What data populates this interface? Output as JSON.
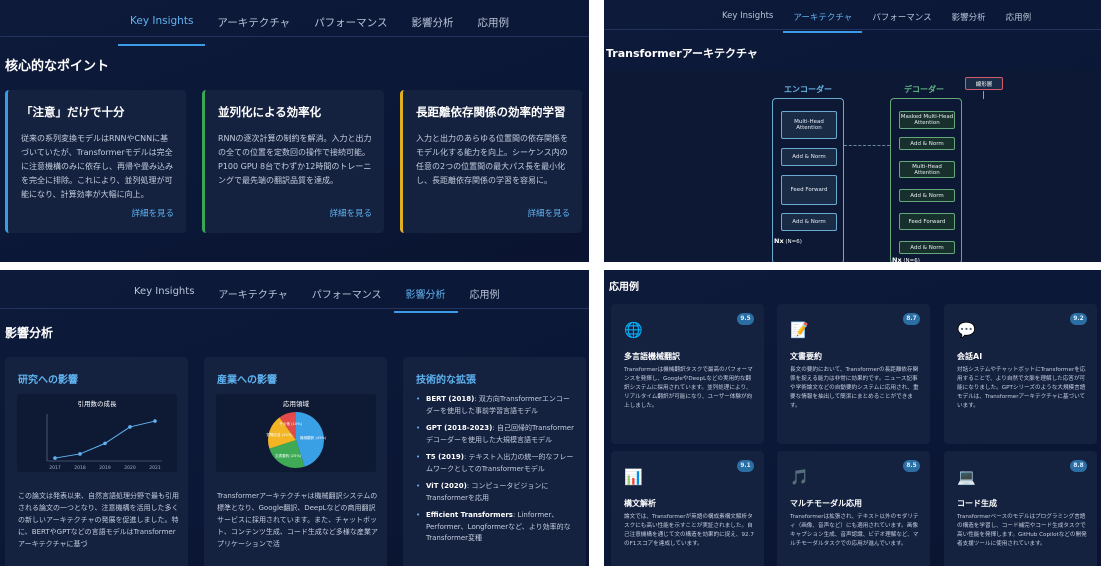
{
  "tabs": [
    "Key Insights",
    "アーキテクチャ",
    "パフォーマンス",
    "影響分析",
    "応用例"
  ],
  "insights": {
    "title": "核心的なポイント",
    "more_label": "詳細を見る",
    "cards": [
      {
        "title": "「注意」だけで十分",
        "body": "従来の系列変換モデルはRNNやCNNに基づいていたが、Transformerモデルは完全に注意機構のみに依存し、再帰や畳み込みを完全に排除。これにより、並列処理が可能になり、計算効率が大幅に向上。",
        "accent": "#3b9be6"
      },
      {
        "title": "並列化による効率化",
        "body": "RNNの逐次計算の制約を解消。入力と出力の全ての位置を定数回の操作で接続可能。P100 GPU 8台でわずか12時間のトレーニングで最先端の翻訳品質を達成。",
        "accent": "#3aa557"
      },
      {
        "title": "長距離依存関係の効率的学習",
        "body": "入力と出力のあらゆる位置間の依存関係をモデル化する能力を向上。シーケンス内の任意の2つの位置間の最大パス長を最小化し、長距離依存関係の学習を容易に。",
        "accent": "#e0b021"
      }
    ]
  },
  "architecture": {
    "title": "Transformerアーキテクチャ",
    "encoder_label": "エンコーダー",
    "decoder_label": "デコーダー",
    "output_label": "線形層",
    "encoder_blocks": [
      "Multi-Head Attention",
      "Add & Norm",
      "Feed Forward",
      "Add & Norm"
    ],
    "decoder_blocks": [
      "Masked Multi-Head Attention",
      "Add & Norm",
      "Multi-Head Attention",
      "Add & Norm",
      "Feed Forward",
      "Add & Norm"
    ],
    "nx_label": "Nx",
    "nx_value": "(N=6)",
    "colors": {
      "encoder": "#6ba9cf",
      "decoder": "#62a87a",
      "output": "#d35b6b"
    }
  },
  "impact": {
    "title": "影響分析",
    "research": {
      "title": "研究への影響",
      "chart_title": "引用数の成長",
      "desc": "この論文は発表以来、自然言語処理分野で最も引用される論文の一つとなり、注意機構を活用した多くの新しいアーキテクチャの発展を促進しました。特に、BERTやGPTなどの言語モデルはTransformerアーキテクチャに基づ"
    },
    "industry": {
      "title": "産業への影響",
      "chart_title": "応用領域",
      "desc": "Transformerアーキテクチャは機械翻訳システムの標準となり、Google翻訳、DeepLなどの商用翻訳サービスに採用されています。また、チャットボット、コンテンツ生成、コード生成など多様な産業アプリケーションで活"
    },
    "extensions": {
      "title": "技術的な拡張",
      "items": [
        {
          "name": "BERT (2018)",
          "text": ": 双方向Transformerエンコーダーを使用した事前学習言語モデル"
        },
        {
          "name": "GPT (2018-2023)",
          "text": ": 自己回帰的Transformerデコーダーを使用した大規模言語モデル"
        },
        {
          "name": "T5 (2019)",
          "text": ": テキスト入出力の統一的なフレームワークとしてのTransformerモデル"
        },
        {
          "name": "ViT (2020)",
          "text": ": コンピュータビジョンにTransformerを応用"
        },
        {
          "name": "Efficient Transformers",
          "text": ": Linformer、Performer、Longformerなど、より効率的なTransformer変種"
        }
      ]
    }
  },
  "chart_data": [
    {
      "type": "line",
      "title": "引用数の成長",
      "x": [
        "2017",
        "2018",
        "2019",
        "2020",
        "2021"
      ],
      "series": [
        {
          "values": [
            5,
            12,
            30,
            58,
            68
          ]
        }
      ],
      "ylim": [
        0,
        80
      ],
      "grid": false,
      "color": "#5fb3f0"
    },
    {
      "type": "pie",
      "title": "応用領域",
      "labels": [
        "機械翻訳 (45%)",
        "文書要約 (25%)",
        "質問応答 (20%)",
        "その他 (10%)"
      ],
      "values": [
        45,
        25,
        20,
        10
      ],
      "colors": [
        "#3aa0e6",
        "#3faa55",
        "#f3b523",
        "#e34b4b"
      ]
    }
  ],
  "applications": {
    "title": "応用例",
    "items": [
      {
        "icon": "🌐",
        "icon_name": "globe-icon",
        "score": "9.5",
        "title": "多言語機械翻訳",
        "body": "Transformerは機械翻訳タスクで最高のパフォーマンスを発揮し、GoogleやDeepLなどの実用的な翻訳システムに採用されています。並列処理により、リアルタイム翻訳が可能になり、ユーザー体験が向上しました。"
      },
      {
        "icon": "📝",
        "icon_name": "memo-icon",
        "score": "8.7",
        "title": "文書要約",
        "body": "長文の要約において、Transformerの長距離依存関係を捉える能力は非常に効果的です。ニュース記事や学術論文などの自動要約システムに応用され、重要な情報を抽出して簡潔にまとめることができます。"
      },
      {
        "icon": "💬",
        "icon_name": "speech-bubble-icon",
        "score": "9.2",
        "title": "会話AI",
        "body": "対話システムやチャットボットにTransformerを応用することで、より自然で文脈を理解した応答が可能になりました。GPTシリーズのような大規模言語モデルは、Transformerアーキテクチャに基づいています。"
      },
      {
        "icon": "📊",
        "icon_name": "bar-chart-icon",
        "score": "9.1",
        "title": "構文解析",
        "body": "論文では、Transformerが英語の構成素構文解析タスクにも高い性能を示すことが実証されました。自己注意機構を通じて文の構造を効果的に捉え、92.7のF1スコアを達成しています。"
      },
      {
        "icon": "🎵",
        "icon_name": "music-note-icon",
        "score": "8.5",
        "title": "マルチモーダル応用",
        "body": "Transformerは拡張され、テキスト以外のモダリティ（画像、音声など）にも適用されています。画像キャプション生成、音声認識、ビデオ理解など、マルチモーダルタスクでの応用が進んでいます。"
      },
      {
        "icon": "💻",
        "icon_name": "laptop-icon",
        "score": "8.8",
        "title": "コード生成",
        "body": "Transformerベースのモデルはプログラミング言語の構造を学習し、コード補完やコード生成タスクで高い性能を発揮します。GitHub Copilotなどの開発者支援ツールに使用されています。"
      }
    ]
  }
}
